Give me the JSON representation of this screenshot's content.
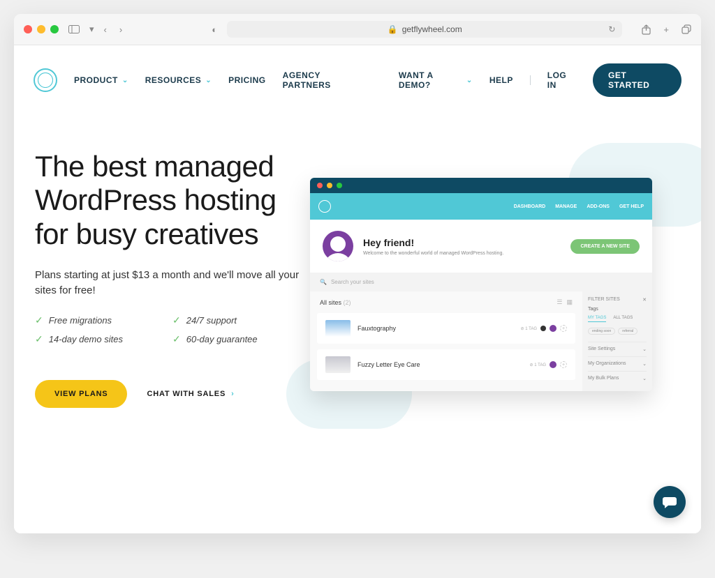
{
  "browser": {
    "url_host": "getflywheel.com"
  },
  "nav": {
    "items": [
      "PRODUCT",
      "RESOURCES",
      "PRICING",
      "AGENCY PARTNERS"
    ],
    "demo": "WANT A DEMO?",
    "help": "HELP",
    "login": "LOG IN",
    "cta": "GET STARTED"
  },
  "hero": {
    "headline": "The best managed WordPress hosting for busy creatives",
    "subtext": "Plans starting at just $13 a month and we'll move all your sites for free!",
    "features": [
      "Free migrations",
      "24/7 support",
      "14-day demo sites",
      "60-day guarantee"
    ],
    "cta_primary": "VIEW PLANS",
    "cta_secondary": "CHAT WITH SALES"
  },
  "dashboard": {
    "nav_items": [
      "DASHBOARD",
      "MANAGE",
      "ADD-ONS",
      "GET HELP"
    ],
    "greeting": "Hey friend!",
    "greeting_sub": "Welcome to the wonderful world of managed WordPress hosting.",
    "create_btn": "CREATE A NEW SITE",
    "search_placeholder": "Search your sites",
    "filter_label": "FILTER SITES",
    "all_sites_label": "All sites",
    "all_sites_count": "(2)",
    "sites": [
      {
        "name": "Fauxtography",
        "tag": "1 TAG"
      },
      {
        "name": "Fuzzy Letter Eye Care",
        "tag": "1 TAG"
      }
    ],
    "sidebar": {
      "header": "Tags",
      "tabs": [
        "MY TAGS",
        "ALL TAGS"
      ],
      "pills": [
        "ending soon",
        "referral"
      ],
      "links": [
        "Site Settings",
        "My Organizations",
        "My Bulk Plans"
      ]
    }
  }
}
